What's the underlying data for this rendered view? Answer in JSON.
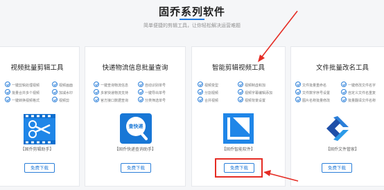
{
  "header": {
    "title": "固乔系列软件",
    "subtitle": "简单便捷的剪辑工具，让你轻松解决运营难题"
  },
  "cards": [
    {
      "title": "视频批量剪辑工具",
      "features": [
        "一键剪辑处理视频",
        "视频画面",
        "批量合并多个视频",
        "加减水印",
        "一键转换视频格式",
        "视频剪"
      ],
      "caption": "【固乔剪辑助手】",
      "button": "免费下载"
    },
    {
      "title": "快递物流信息批量查询",
      "features": [
        "一键查询物流信息",
        "自动识别单号",
        "多家快递物流支持",
        "一键导出单号",
        "官方接口数据查询",
        "分类筛选单号"
      ],
      "caption": "【固乔快递查询助手】",
      "icon_text": "查快递",
      "button": "免费下载"
    },
    {
      "title": "智能剪辑视频工具",
      "features": [
        "视频变型",
        "视频制虚和加",
        "分割视频",
        "视频字幕编辑添加",
        "合并视频",
        "视频背景设置"
      ],
      "caption": "【固乔智能软件】",
      "button": "免费下载"
    },
    {
      "title": "文件批量改名工具",
      "features": [
        "文件批量重命名",
        "一键修改文件名字",
        "文件数字序号设置",
        "自定义文件名重复",
        "图片名称批量修改",
        "批量翻译文件名称"
      ],
      "caption": "【固乔文件管家】",
      "button": "免费下载"
    }
  ],
  "colors": {
    "accent": "#2b7fd9",
    "highlight": "#e52c24",
    "background": "#f5f6f8"
  },
  "icons": {
    "card1": "scissors-film-icon",
    "card2": "magnifier-delivery-icon",
    "card3": "crop-frame-icon",
    "card4": "arrow-chevron-icon"
  }
}
